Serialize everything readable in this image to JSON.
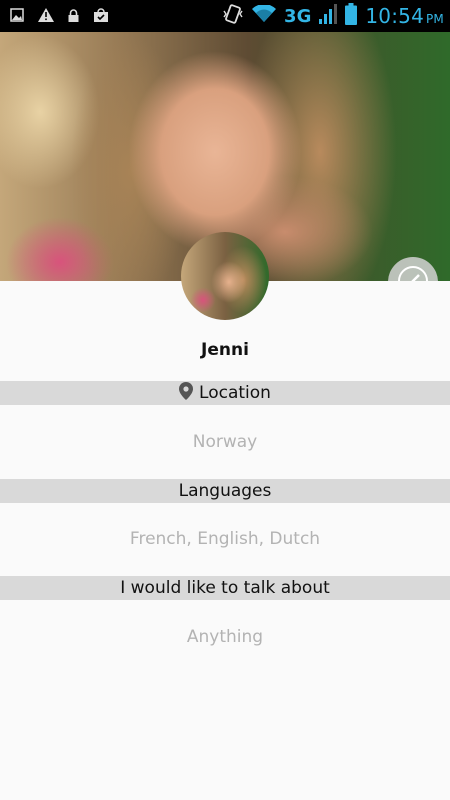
{
  "status_bar": {
    "time": "10:54",
    "ampm": "PM",
    "network": "3G",
    "icons": [
      "image-notification-icon",
      "warning-icon",
      "lock-icon",
      "store-bag-icon",
      "vibrate-icon",
      "wifi-icon",
      "signal-icon",
      "battery-icon"
    ],
    "accent_color": "#33b5e5"
  },
  "profile": {
    "name": "Jenni",
    "cover_action_icon": "edit-cover-icon"
  },
  "sections": {
    "location": {
      "label": "Location",
      "icon": "location-pin-icon",
      "value": "Norway"
    },
    "languages": {
      "label": "Languages",
      "value": "French, English, Dutch"
    },
    "topics": {
      "label": "I would like to talk about",
      "value": "Anything"
    }
  },
  "colors": {
    "section_header_bg": "#d9d9d9",
    "value_text": "#b3b3b3",
    "background": "#fafafa"
  }
}
